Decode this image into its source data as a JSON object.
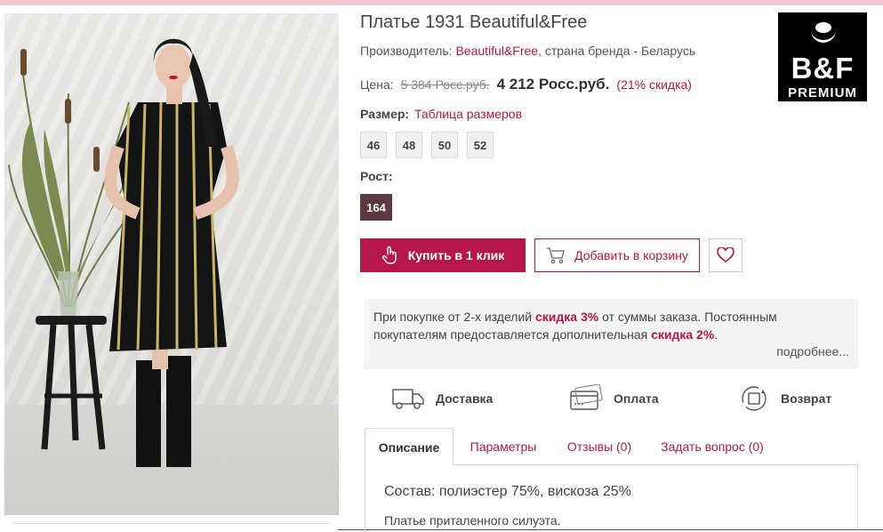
{
  "product": {
    "title": "Платье 1931 Beautiful&Free",
    "maker_prefix": "Производитель:",
    "maker_link": "Beautiful&Free",
    "maker_suffix": ", страна бренда - Беларусь",
    "price_label": "Цена:",
    "old_price": "5 384 Росс.руб.",
    "new_price": "4 212 Росс.руб.",
    "discount": "(21% скидка)"
  },
  "logo": {
    "line1": "B&F",
    "line2": "PREMIUM"
  },
  "size": {
    "label": "Размер:",
    "table_link": "Таблица размеров",
    "options": [
      "46",
      "48",
      "50",
      "52"
    ]
  },
  "height": {
    "label": "Рост:",
    "selected": "164"
  },
  "actions": {
    "buy_one_click": "Купить в 1 клик",
    "add_to_cart": "Добавить в корзину"
  },
  "promo": {
    "t1": "При покупке от 2-х изделий ",
    "b1": "скидка 3%",
    "t2": " от суммы заказа. Постоянным покупателям предоставляется дополнительная ",
    "b2": "скидка 2%",
    "t3": ".",
    "more": "подробнее..."
  },
  "features": [
    {
      "label": "Доставка",
      "icon": "truck-icon"
    },
    {
      "label": "Оплата",
      "icon": "card-icon"
    },
    {
      "label": "Возврат",
      "icon": "return-icon"
    }
  ],
  "tabs": [
    "Описание",
    "Параметры",
    "Отзывы (0)",
    "Задать вопрос (0)"
  ],
  "description": {
    "composition": "Состав: полиэстер 75%, вискоза 25%",
    "text": "Платье приталенного силуэта."
  },
  "colors": {
    "accent": "#b5174b",
    "selected_height": "#5c3a3f"
  }
}
